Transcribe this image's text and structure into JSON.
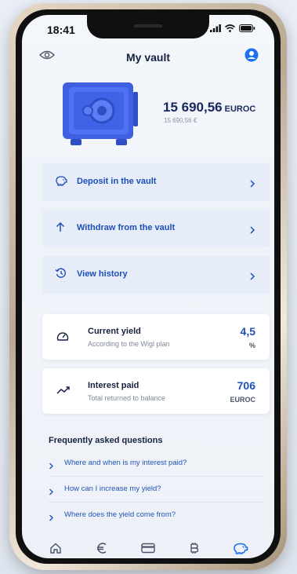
{
  "status_bar": {
    "time": "18:41"
  },
  "header": {
    "title": "My vault"
  },
  "vault": {
    "balance_amount": "15 690,56",
    "balance_currency": "EUROC",
    "balance_converted": "15 690,56 €"
  },
  "actions": [
    {
      "label": "Deposit in the vault",
      "icon": "piggy-bank-icon"
    },
    {
      "label": "Withdraw from the vault",
      "icon": "arrow-up-icon"
    },
    {
      "label": "View history",
      "icon": "history-icon"
    }
  ],
  "cards": {
    "yield": {
      "title": "Current yield",
      "subtitle": "According to the Wigl plan",
      "value": "4,5",
      "unit": "%"
    },
    "interest": {
      "title": "Interest paid",
      "subtitle": "Total returned to balance",
      "value": "706",
      "unit": "EUROC"
    }
  },
  "faq": {
    "title": "Frequently asked questions",
    "items": [
      "Where and when is my interest paid?",
      "How can I increase my yield?",
      "Where does the yield come from?"
    ]
  },
  "nav": [
    "home-icon",
    "euro-icon",
    "card-icon",
    "bitcoin-icon",
    "piggy-bank-icon"
  ],
  "colors": {
    "accent": "#1d4fb8",
    "title": "#15223f",
    "action_bg": "#e6edf8",
    "active_nav": "#1d6ff0"
  }
}
